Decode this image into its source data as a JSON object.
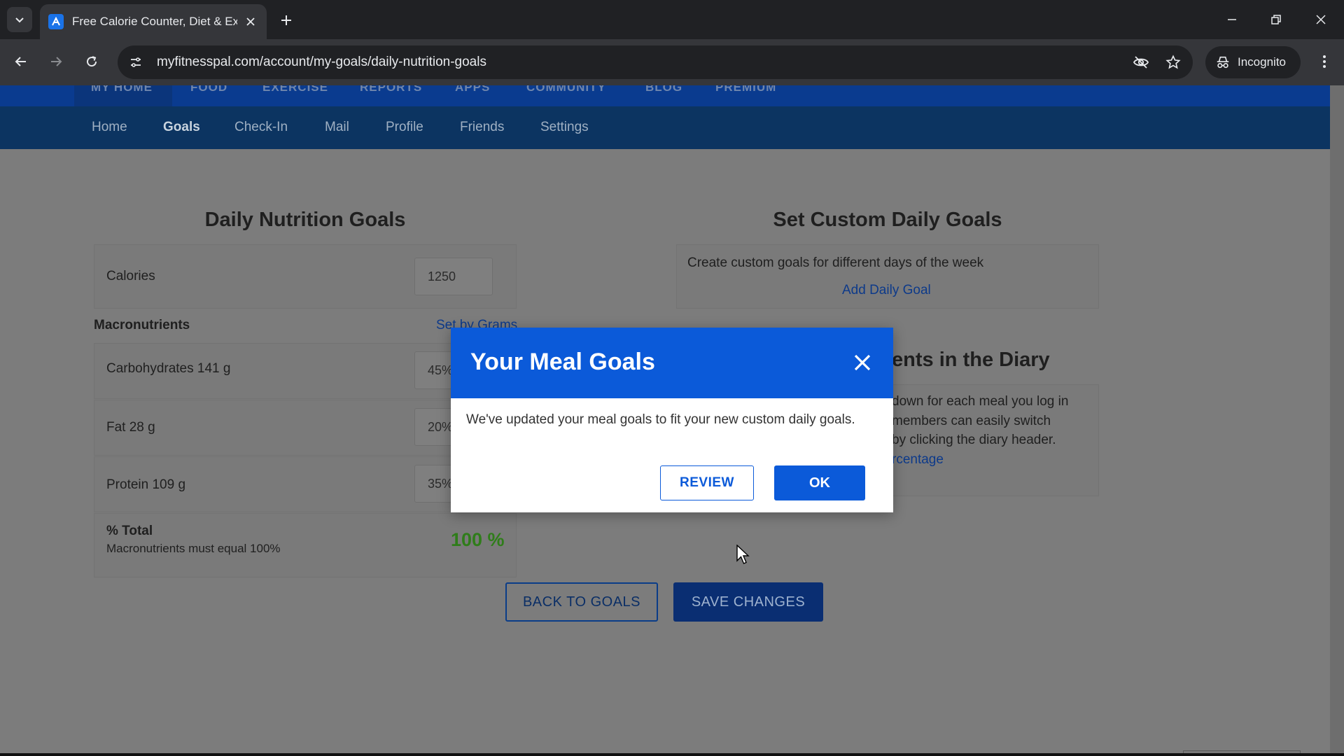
{
  "browser": {
    "tab_title": "Free Calorie Counter, Diet & Ex",
    "url": "myfitnesspal.com/account/my-goals/daily-nutrition-goals",
    "incognito_label": "Incognito"
  },
  "top_nav": {
    "items": [
      "MY HOME",
      "FOOD",
      "EXERCISE",
      "REPORTS",
      "APPS",
      "COMMUNITY",
      "BLOG",
      "PREMIUM"
    ]
  },
  "sub_nav": {
    "items": [
      "Home",
      "Goals",
      "Check-In",
      "Mail",
      "Profile",
      "Friends",
      "Settings"
    ],
    "active": "Goals"
  },
  "nutrition": {
    "title": "Daily Nutrition Goals",
    "calories_label": "Calories",
    "calories_value": "1250",
    "macros_label": "Macronutrients",
    "set_by_grams": "Set by Grams",
    "carbs_label": "Carbohydrates 141 g",
    "carbs_value": "45%",
    "fat_label": "Fat 28 g",
    "fat_value": "20%",
    "protein_label": "Protein 109 g",
    "protein_value": "35%",
    "total_label": "% Total",
    "total_note": "Macronutrients must equal 100%",
    "total_value": "100 %"
  },
  "custom_goals": {
    "title": "Set Custom Daily Goals",
    "description": "Create custom goals for different days of the week",
    "add_link": "Add Daily Goal"
  },
  "diary": {
    "title_fragment": "ients in the Diary",
    "line1": "down for each meal you log in",
    "line2": "members can easily switch",
    "line3": "by clicking the diary header.",
    "link_fragment": "rcentage"
  },
  "actions": {
    "back": "BACK TO GOALS",
    "save": "SAVE CHANGES"
  },
  "modal": {
    "title": "Your Meal Goals",
    "body": "We've updated your meal goals to fit your new custom daily goals.",
    "review": "REVIEW",
    "ok": "OK"
  },
  "colors": {
    "modal_header": "#0b5ad9",
    "nav_dark": "#0c3461",
    "total_green": "#2f7d1a"
  }
}
